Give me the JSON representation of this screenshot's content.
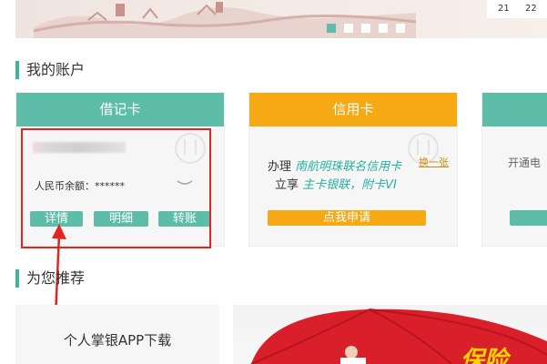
{
  "banner": {
    "date_numbers": [
      "21",
      "22"
    ],
    "slide_count": 5,
    "active_slide": 0
  },
  "my_account": {
    "title": "我的账户"
  },
  "debit_card": {
    "header": "借记卡",
    "balance_label": "人民币余额：******",
    "buttons": [
      "详情",
      "明细",
      "转账"
    ]
  },
  "credit_card": {
    "header": "信用卡",
    "line1_prefix": "办理",
    "line1_highlight": "南航明珠联名信用卡",
    "swap_link": "换一张",
    "line2_prefix": "立享",
    "line2_highlight": "主卡银联，附卡VI",
    "apply_button": "点我申请"
  },
  "third_card": {
    "text": "开通电"
  },
  "recommend": {
    "title": "为您推荐",
    "app_download": "个人掌银APP下载",
    "banner_text": "保险"
  },
  "colors": {
    "teal": "#5dbda9",
    "orange": "#f5a914",
    "highlight_red": "#e0261f"
  }
}
